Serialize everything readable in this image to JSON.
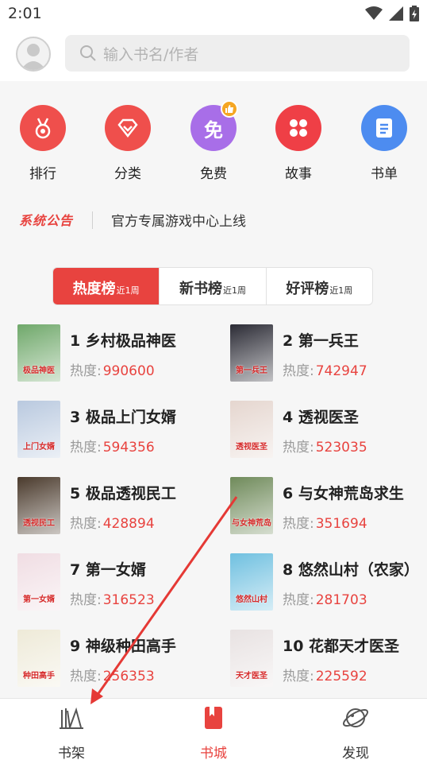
{
  "status_bar": {
    "time": "2:01"
  },
  "search": {
    "placeholder": "输入书名/作者"
  },
  "quick_nav": [
    {
      "label": "排行",
      "icon": "medal-icon",
      "color": "#ef4f4c"
    },
    {
      "label": "分类",
      "icon": "diamond-icon",
      "color": "#ef4f4c"
    },
    {
      "label": "免费",
      "icon": "free-icon",
      "color": "#a86ee8",
      "icon_text": "免"
    },
    {
      "label": "故事",
      "icon": "grid-icon",
      "color": "#ef3f46"
    },
    {
      "label": "书单",
      "icon": "list-doc-icon",
      "color": "#4d8cf0"
    }
  ],
  "notice": {
    "tag": "系统公告",
    "text": "官方专属游戏中心上线"
  },
  "tabs": [
    {
      "main": "热度榜",
      "sub": "近1周",
      "active": true
    },
    {
      "main": "新书榜",
      "sub": "近1周",
      "active": false
    },
    {
      "main": "好评榜",
      "sub": "近1周",
      "active": false
    }
  ],
  "heat_label": "热度:",
  "books": [
    {
      "title": "1 乡村极品神医",
      "heat": "990600",
      "cover_text": "极品神医",
      "cover_color": "#6fa86a"
    },
    {
      "title": "2 第一兵王",
      "heat": "742947",
      "cover_text": "第一兵王",
      "cover_color": "#2b2b35"
    },
    {
      "title": "3 极品上门女婿",
      "heat": "594356",
      "cover_text": "上门女婿",
      "cover_color": "#b9c9df"
    },
    {
      "title": "4 透视医圣",
      "heat": "523035",
      "cover_text": "透视医圣",
      "cover_color": "#e5d6cf"
    },
    {
      "title": "5 极品透视民工",
      "heat": "428894",
      "cover_text": "透视民工",
      "cover_color": "#4a3a2c"
    },
    {
      "title": "6 与女神荒岛求生",
      "heat": "351694",
      "cover_text": "与女神荒岛",
      "cover_color": "#6f8a5a"
    },
    {
      "title": "7 第一女婿",
      "heat": "316523",
      "cover_text": "第一女婿",
      "cover_color": "#f0dde3"
    },
    {
      "title": "8 悠然山村（农家）",
      "heat": "281703",
      "cover_text": "悠然山村",
      "cover_color": "#6fc0e0"
    },
    {
      "title": "9 神级种田高手",
      "heat": "256353",
      "cover_text": "种田高手",
      "cover_color": "#eeead8"
    },
    {
      "title": "10 花都天才医圣",
      "heat": "225592",
      "cover_text": "天才医圣",
      "cover_color": "#e8e2e2"
    }
  ],
  "tabbar": [
    {
      "label": "书架",
      "icon": "bookshelf-icon",
      "active": false
    },
    {
      "label": "书城",
      "icon": "bookstore-icon",
      "active": true
    },
    {
      "label": "发现",
      "icon": "planet-icon",
      "active": false
    }
  ],
  "colors": {
    "accent": "#e8433f",
    "text": "#222222",
    "muted": "#9a9a9a"
  }
}
